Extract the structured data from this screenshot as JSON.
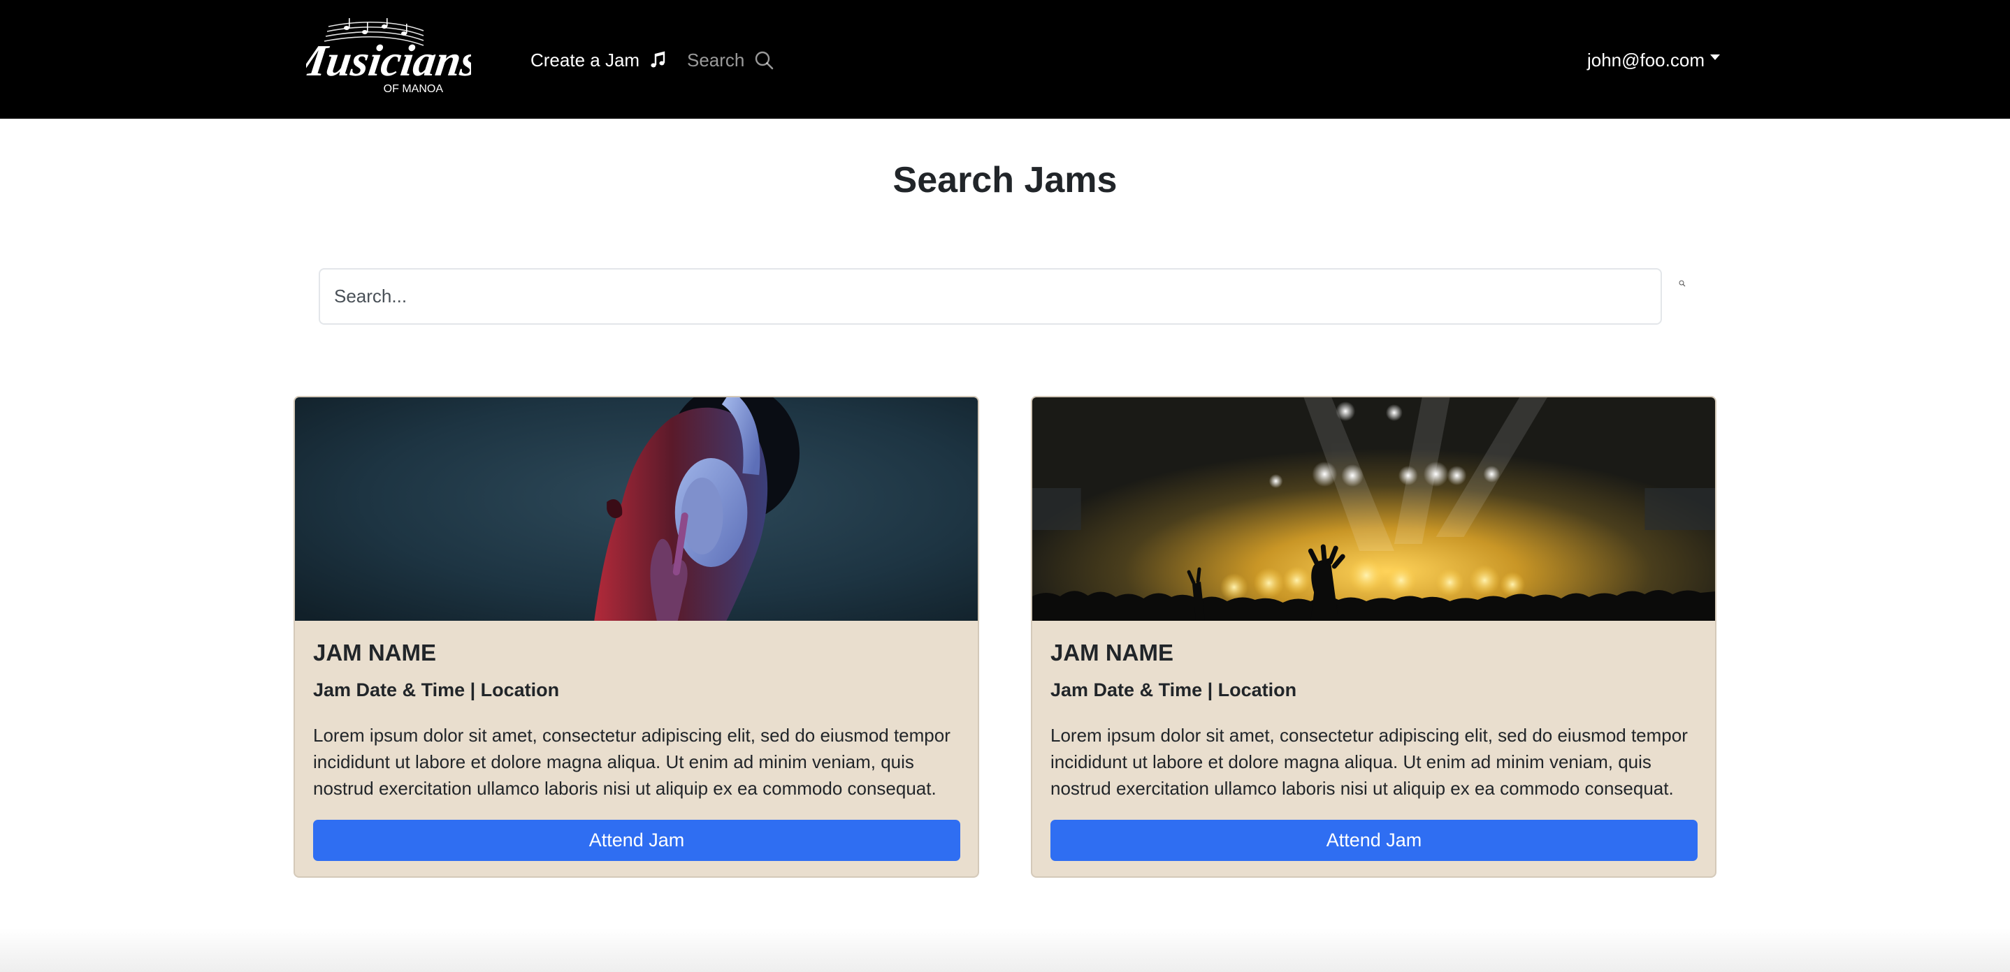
{
  "navbar": {
    "brand_text": "Musicians",
    "brand_subtext": "OF MANOA",
    "create_label": "Create a Jam",
    "create_icon": "music-note-icon",
    "search_label": "Search",
    "search_icon": "search-icon",
    "user_email": "john@foo.com",
    "user_icon": "caret-down-icon"
  },
  "page": {
    "title": "Search Jams"
  },
  "search": {
    "placeholder": "Search...",
    "value": "",
    "submit_icon": "search-icon"
  },
  "jams": [
    {
      "title": "JAM NAME",
      "subtitle": "Jam Date & Time | Location",
      "description": "Lorem ipsum dolor sit amet, consectetur adipiscing elit, sed do eiusmod tempor incididunt ut labore et dolore magna aliqua. Ut enim ad minim veniam, quis nostrud exercitation ullamco laboris nisi ut aliquip ex ea commodo consequat.",
      "button_label": "Attend Jam",
      "image": "woman-with-headphones-photo"
    },
    {
      "title": "JAM NAME",
      "subtitle": "Jam Date & Time | Location",
      "description": "Lorem ipsum dolor sit amet, consectetur adipiscing elit, sed do eiusmod tempor incididunt ut labore et dolore magna aliqua. Ut enim ad minim veniam, quis nostrud exercitation ullamco laboris nisi ut aliquip ex ea commodo consequat.",
      "button_label": "Attend Jam",
      "image": "concert-crowd-photo"
    }
  ],
  "colors": {
    "navbar_bg": "#000000",
    "card_bg": "#e9dece",
    "button_bg": "#2f6ef2",
    "text": "#212529"
  }
}
